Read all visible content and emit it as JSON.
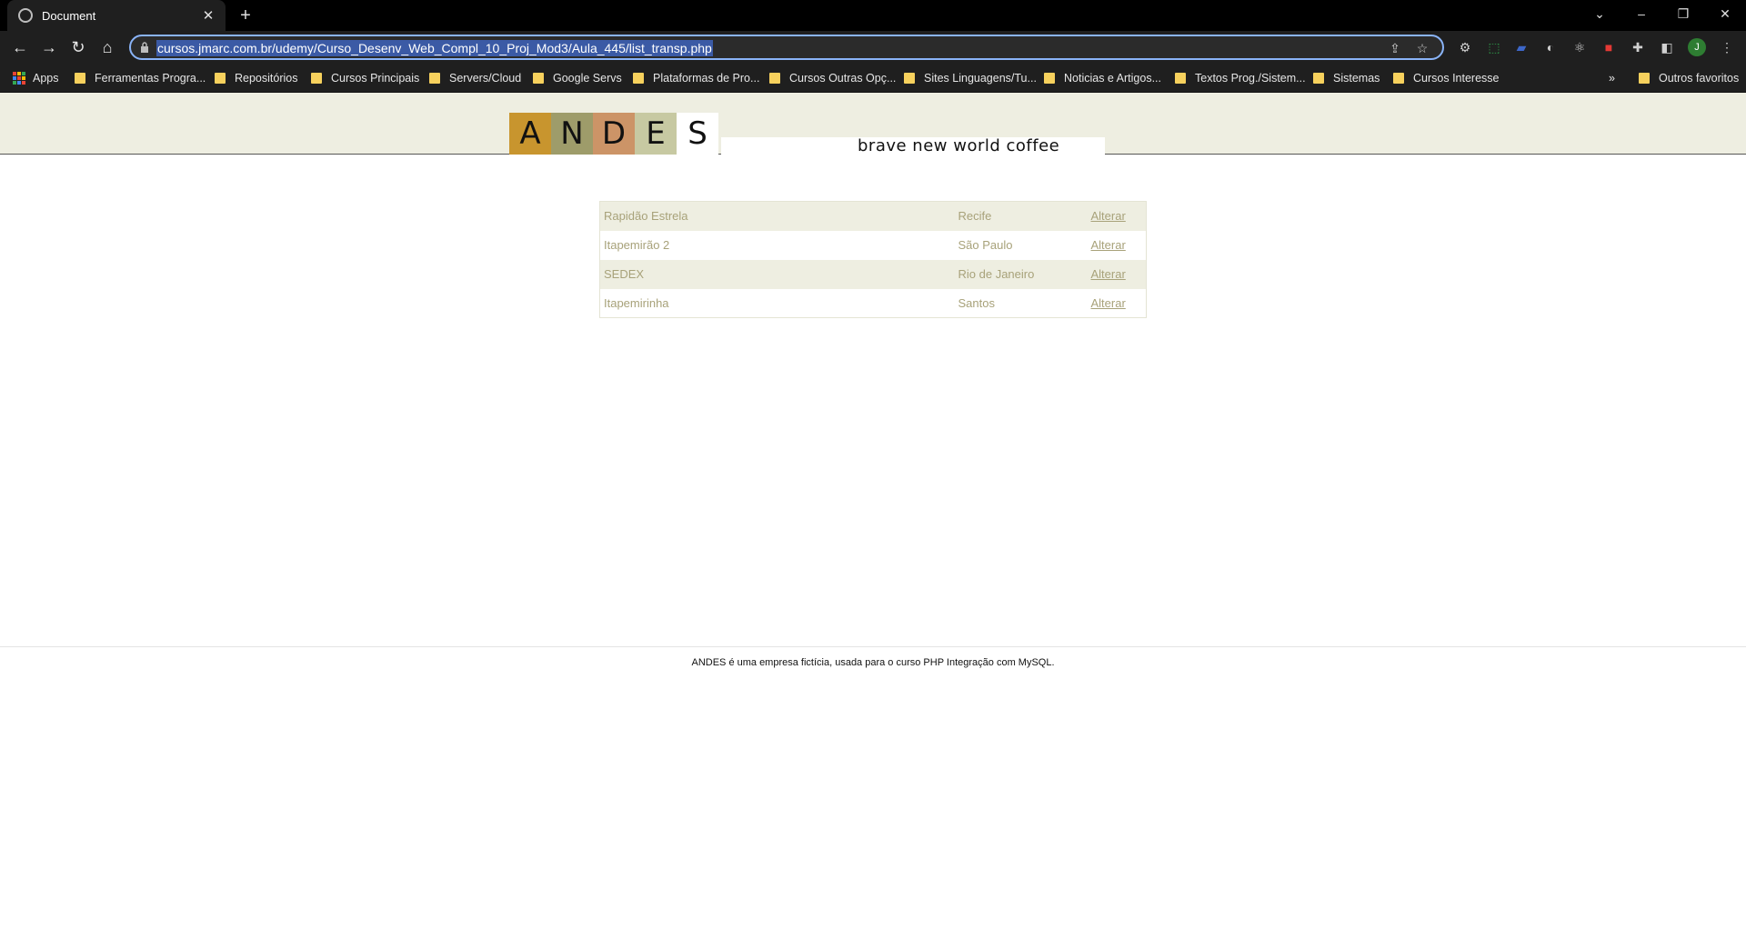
{
  "browser": {
    "tab_title": "Document",
    "url": "cursos.jmarc.com.br/udemy/Curso_Desenv_Web_Compl_10_Proj_Mod3/Aula_445/list_transp.php",
    "new_tab_icon": "plus-icon",
    "profile_initial": "J",
    "bookmarks": [
      {
        "label": "Apps",
        "type": "apps"
      },
      {
        "label": "Ferramentas Progra...",
        "type": "folder"
      },
      {
        "label": "Repositórios",
        "type": "folder"
      },
      {
        "label": "Cursos Principais",
        "type": "folder"
      },
      {
        "label": "Servers/Cloud",
        "type": "folder"
      },
      {
        "label": "Google Servs",
        "type": "folder"
      },
      {
        "label": "Plataformas de Pro...",
        "type": "folder"
      },
      {
        "label": "Cursos Outras Opç...",
        "type": "folder"
      },
      {
        "label": "Sites Linguagens/Tu...",
        "type": "folder"
      },
      {
        "label": "Noticias e Artigos...",
        "type": "folder"
      },
      {
        "label": "Textos Prog./Sistem...",
        "type": "folder"
      },
      {
        "label": "Sistemas",
        "type": "folder"
      },
      {
        "label": "Cursos Interesse",
        "type": "folder"
      }
    ],
    "overflow_label": "»",
    "other_bookmarks": "Outros favoritos"
  },
  "brand": {
    "letters": [
      {
        "char": "A",
        "color": "#c8952e"
      },
      {
        "char": "N",
        "color": "#9e9c6a"
      },
      {
        "char": "D",
        "color": "#cc9467"
      },
      {
        "char": "E",
        "color": "#c7c9a2"
      },
      {
        "char": "S",
        "color": "#ffffff"
      }
    ],
    "tagline": "brave new world coffee"
  },
  "transportadoras": [
    {
      "name": "Rapidão Estrela",
      "city": "Recife",
      "action": "Alterar"
    },
    {
      "name": "Itapemirão 2",
      "city": "São Paulo",
      "action": "Alterar"
    },
    {
      "name": "SEDEX",
      "city": "Rio de Janeiro",
      "action": "Alterar"
    },
    {
      "name": "Itapemirinha",
      "city": "Santos",
      "action": "Alterar"
    }
  ],
  "footer": {
    "text": "ANDES é uma empresa fictícia, usada para o curso PHP Integração com MySQL."
  },
  "colors": {
    "header_bg": "#eeeee1",
    "row_alt_bg": "#eeeee1",
    "text_olive": "#a8a27a"
  }
}
